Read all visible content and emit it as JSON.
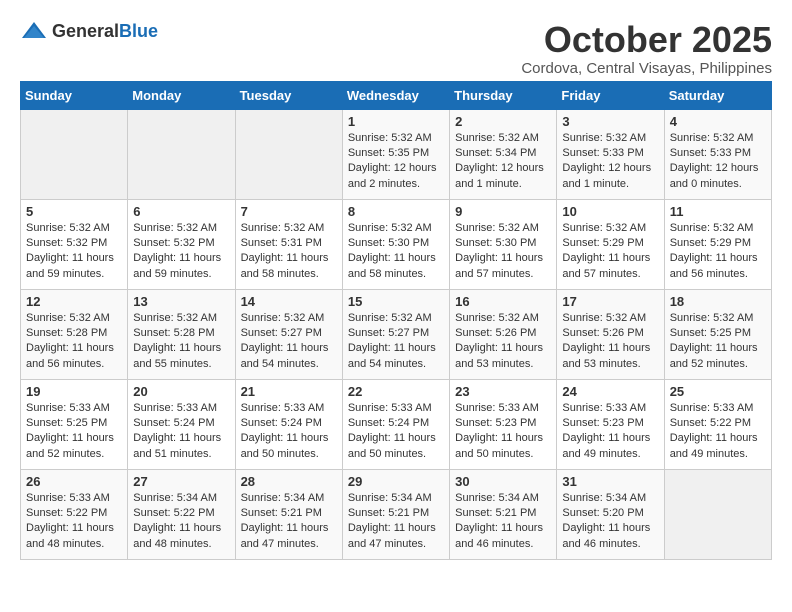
{
  "logo": {
    "general": "General",
    "blue": "Blue"
  },
  "title": "October 2025",
  "location": "Cordova, Central Visayas, Philippines",
  "days_of_week": [
    "Sunday",
    "Monday",
    "Tuesday",
    "Wednesday",
    "Thursday",
    "Friday",
    "Saturday"
  ],
  "weeks": [
    [
      {
        "day": "",
        "sunrise": "",
        "sunset": "",
        "daylight": "",
        "empty": true
      },
      {
        "day": "",
        "sunrise": "",
        "sunset": "",
        "daylight": "",
        "empty": true
      },
      {
        "day": "",
        "sunrise": "",
        "sunset": "",
        "daylight": "",
        "empty": true
      },
      {
        "day": "1",
        "sunrise": "Sunrise: 5:32 AM",
        "sunset": "Sunset: 5:35 PM",
        "daylight": "Daylight: 12 hours and 2 minutes."
      },
      {
        "day": "2",
        "sunrise": "Sunrise: 5:32 AM",
        "sunset": "Sunset: 5:34 PM",
        "daylight": "Daylight: 12 hours and 1 minute."
      },
      {
        "day": "3",
        "sunrise": "Sunrise: 5:32 AM",
        "sunset": "Sunset: 5:33 PM",
        "daylight": "Daylight: 12 hours and 1 minute."
      },
      {
        "day": "4",
        "sunrise": "Sunrise: 5:32 AM",
        "sunset": "Sunset: 5:33 PM",
        "daylight": "Daylight: 12 hours and 0 minutes."
      }
    ],
    [
      {
        "day": "5",
        "sunrise": "Sunrise: 5:32 AM",
        "sunset": "Sunset: 5:32 PM",
        "daylight": "Daylight: 11 hours and 59 minutes."
      },
      {
        "day": "6",
        "sunrise": "Sunrise: 5:32 AM",
        "sunset": "Sunset: 5:32 PM",
        "daylight": "Daylight: 11 hours and 59 minutes."
      },
      {
        "day": "7",
        "sunrise": "Sunrise: 5:32 AM",
        "sunset": "Sunset: 5:31 PM",
        "daylight": "Daylight: 11 hours and 58 minutes."
      },
      {
        "day": "8",
        "sunrise": "Sunrise: 5:32 AM",
        "sunset": "Sunset: 5:30 PM",
        "daylight": "Daylight: 11 hours and 58 minutes."
      },
      {
        "day": "9",
        "sunrise": "Sunrise: 5:32 AM",
        "sunset": "Sunset: 5:30 PM",
        "daylight": "Daylight: 11 hours and 57 minutes."
      },
      {
        "day": "10",
        "sunrise": "Sunrise: 5:32 AM",
        "sunset": "Sunset: 5:29 PM",
        "daylight": "Daylight: 11 hours and 57 minutes."
      },
      {
        "day": "11",
        "sunrise": "Sunrise: 5:32 AM",
        "sunset": "Sunset: 5:29 PM",
        "daylight": "Daylight: 11 hours and 56 minutes."
      }
    ],
    [
      {
        "day": "12",
        "sunrise": "Sunrise: 5:32 AM",
        "sunset": "Sunset: 5:28 PM",
        "daylight": "Daylight: 11 hours and 56 minutes."
      },
      {
        "day": "13",
        "sunrise": "Sunrise: 5:32 AM",
        "sunset": "Sunset: 5:28 PM",
        "daylight": "Daylight: 11 hours and 55 minutes."
      },
      {
        "day": "14",
        "sunrise": "Sunrise: 5:32 AM",
        "sunset": "Sunset: 5:27 PM",
        "daylight": "Daylight: 11 hours and 54 minutes."
      },
      {
        "day": "15",
        "sunrise": "Sunrise: 5:32 AM",
        "sunset": "Sunset: 5:27 PM",
        "daylight": "Daylight: 11 hours and 54 minutes."
      },
      {
        "day": "16",
        "sunrise": "Sunrise: 5:32 AM",
        "sunset": "Sunset: 5:26 PM",
        "daylight": "Daylight: 11 hours and 53 minutes."
      },
      {
        "day": "17",
        "sunrise": "Sunrise: 5:32 AM",
        "sunset": "Sunset: 5:26 PM",
        "daylight": "Daylight: 11 hours and 53 minutes."
      },
      {
        "day": "18",
        "sunrise": "Sunrise: 5:32 AM",
        "sunset": "Sunset: 5:25 PM",
        "daylight": "Daylight: 11 hours and 52 minutes."
      }
    ],
    [
      {
        "day": "19",
        "sunrise": "Sunrise: 5:33 AM",
        "sunset": "Sunset: 5:25 PM",
        "daylight": "Daylight: 11 hours and 52 minutes."
      },
      {
        "day": "20",
        "sunrise": "Sunrise: 5:33 AM",
        "sunset": "Sunset: 5:24 PM",
        "daylight": "Daylight: 11 hours and 51 minutes."
      },
      {
        "day": "21",
        "sunrise": "Sunrise: 5:33 AM",
        "sunset": "Sunset: 5:24 PM",
        "daylight": "Daylight: 11 hours and 50 minutes."
      },
      {
        "day": "22",
        "sunrise": "Sunrise: 5:33 AM",
        "sunset": "Sunset: 5:24 PM",
        "daylight": "Daylight: 11 hours and 50 minutes."
      },
      {
        "day": "23",
        "sunrise": "Sunrise: 5:33 AM",
        "sunset": "Sunset: 5:23 PM",
        "daylight": "Daylight: 11 hours and 50 minutes."
      },
      {
        "day": "24",
        "sunrise": "Sunrise: 5:33 AM",
        "sunset": "Sunset: 5:23 PM",
        "daylight": "Daylight: 11 hours and 49 minutes."
      },
      {
        "day": "25",
        "sunrise": "Sunrise: 5:33 AM",
        "sunset": "Sunset: 5:22 PM",
        "daylight": "Daylight: 11 hours and 49 minutes."
      }
    ],
    [
      {
        "day": "26",
        "sunrise": "Sunrise: 5:33 AM",
        "sunset": "Sunset: 5:22 PM",
        "daylight": "Daylight: 11 hours and 48 minutes."
      },
      {
        "day": "27",
        "sunrise": "Sunrise: 5:34 AM",
        "sunset": "Sunset: 5:22 PM",
        "daylight": "Daylight: 11 hours and 48 minutes."
      },
      {
        "day": "28",
        "sunrise": "Sunrise: 5:34 AM",
        "sunset": "Sunset: 5:21 PM",
        "daylight": "Daylight: 11 hours and 47 minutes."
      },
      {
        "day": "29",
        "sunrise": "Sunrise: 5:34 AM",
        "sunset": "Sunset: 5:21 PM",
        "daylight": "Daylight: 11 hours and 47 minutes."
      },
      {
        "day": "30",
        "sunrise": "Sunrise: 5:34 AM",
        "sunset": "Sunset: 5:21 PM",
        "daylight": "Daylight: 11 hours and 46 minutes."
      },
      {
        "day": "31",
        "sunrise": "Sunrise: 5:34 AM",
        "sunset": "Sunset: 5:20 PM",
        "daylight": "Daylight: 11 hours and 46 minutes."
      },
      {
        "day": "",
        "sunrise": "",
        "sunset": "",
        "daylight": "",
        "empty": true
      }
    ]
  ]
}
